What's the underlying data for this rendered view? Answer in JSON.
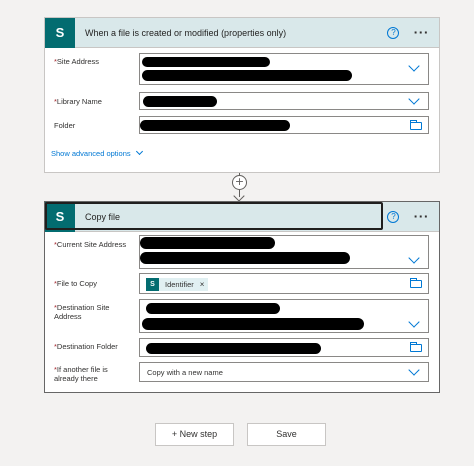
{
  "trigger": {
    "title": "When a file is created or modified (properties only)",
    "help": "?",
    "more": "···",
    "fields": {
      "site_address": "Site Address",
      "library_name": "Library Name",
      "folder": "Folder"
    },
    "advanced": "Show advanced options",
    "required_mark": "*"
  },
  "action": {
    "title": "Copy file",
    "help": "?",
    "more": "···",
    "fields": {
      "current_site": "Current Site Address",
      "file_to_copy": "File to Copy",
      "dest_site": "Destination Site Address",
      "dest_folder": "Destination Folder",
      "if_exists": "If another file is already there"
    },
    "token_label": "Identifier",
    "token_close": "×",
    "if_exists_value": "Copy with a new name",
    "required_mark": "*"
  },
  "connector": {
    "plus": "+"
  },
  "buttons": {
    "new_step": "+ New step",
    "save": "Save"
  },
  "colors": {
    "sharepoint": "#036c70",
    "accent": "#0078d4",
    "required": "#a4262c"
  }
}
